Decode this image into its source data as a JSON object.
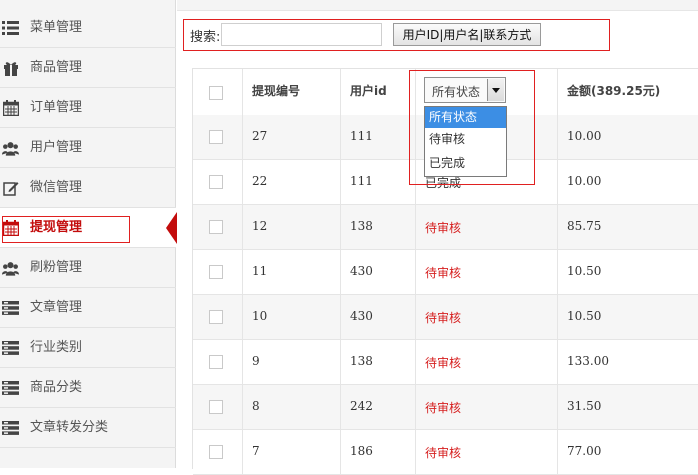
{
  "sidebar": {
    "items": [
      {
        "label": "菜单管理",
        "icon": "list-icon"
      },
      {
        "label": "商品管理",
        "icon": "gift-icon"
      },
      {
        "label": "订单管理",
        "icon": "calendar-icon"
      },
      {
        "label": "用户管理",
        "icon": "users-icon"
      },
      {
        "label": "微信管理",
        "icon": "edit-icon"
      },
      {
        "label": "提现管理",
        "icon": "calendar-icon",
        "active": true
      },
      {
        "label": "刷粉管理",
        "icon": "users-icon"
      },
      {
        "label": "文章管理",
        "icon": "server-icon"
      },
      {
        "label": "行业类别",
        "icon": "server-icon"
      },
      {
        "label": "商品分类",
        "icon": "server-icon"
      },
      {
        "label": "文章转发分类",
        "icon": "server-icon"
      }
    ]
  },
  "search": {
    "label": "搜索:",
    "value": "",
    "button_label": "用户ID|用户名|联系方式"
  },
  "table": {
    "headers": [
      "提现编号",
      "用户id",
      "金额(389.25元)"
    ],
    "status_filter": {
      "selected": "所有状态",
      "options": [
        "所有状态",
        "待审核",
        "已完成"
      ]
    },
    "rows": [
      {
        "id": "27",
        "user": "111",
        "status": "",
        "amount": "10.00"
      },
      {
        "id": "22",
        "user": "111",
        "status": "已完成",
        "amount": "10.00"
      },
      {
        "id": "12",
        "user": "138",
        "status": "待审核",
        "amount": "85.75"
      },
      {
        "id": "11",
        "user": "430",
        "status": "待审核",
        "amount": "10.50"
      },
      {
        "id": "10",
        "user": "430",
        "status": "待审核",
        "amount": "10.50"
      },
      {
        "id": "9",
        "user": "138",
        "status": "待审核",
        "amount": "133.00"
      },
      {
        "id": "8",
        "user": "242",
        "status": "待审核",
        "amount": "31.50"
      },
      {
        "id": "7",
        "user": "186",
        "status": "待审核",
        "amount": "77.00"
      }
    ]
  },
  "colors": {
    "accent_red": "#c30c0c",
    "pending_red": "#d62020",
    "dropdown_highlight": "#3c8ee4"
  }
}
